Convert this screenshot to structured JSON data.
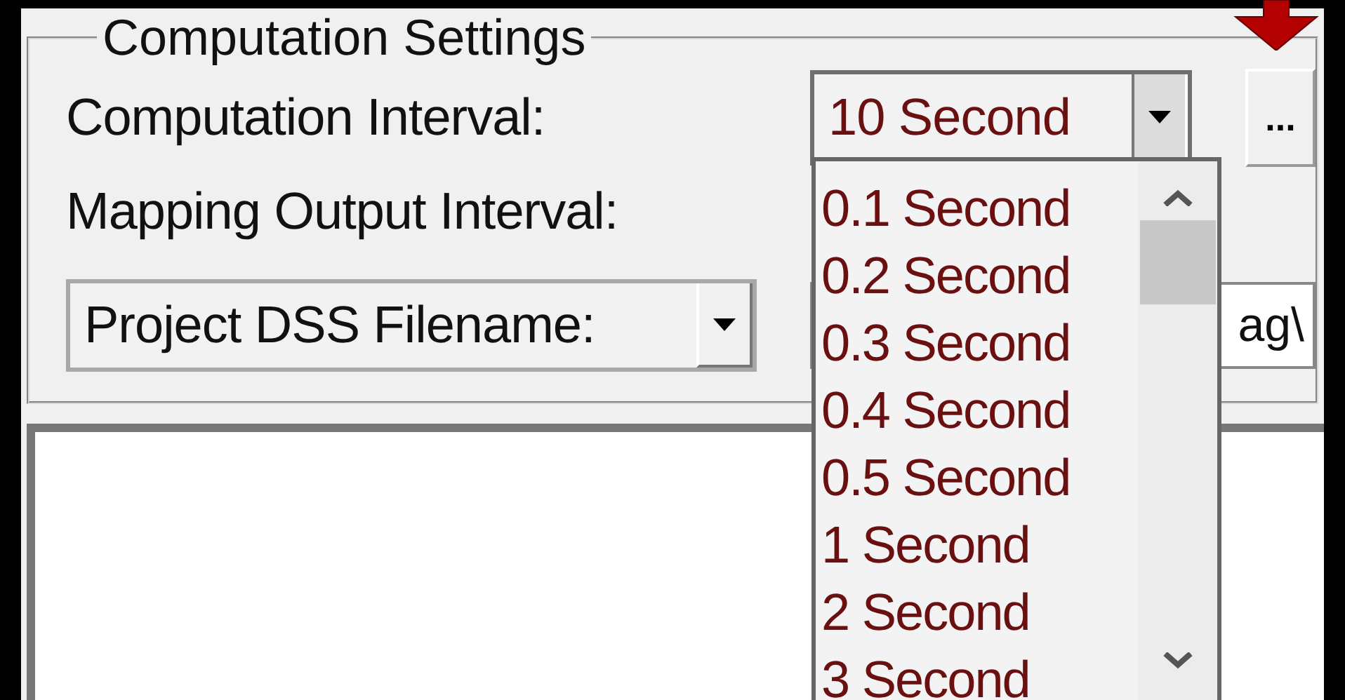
{
  "group": {
    "title": "Computation Settings"
  },
  "computation_interval": {
    "label": "Computation Interval:",
    "value": "10 Second",
    "expanded": true,
    "options": [
      {
        "label": "0.1 Second",
        "selected": false
      },
      {
        "label": "0.2 Second",
        "selected": false
      },
      {
        "label": "0.3 Second",
        "selected": false
      },
      {
        "label": "0.4 Second",
        "selected": false
      },
      {
        "label": "0.5 Second",
        "selected": false
      },
      {
        "label": "1 Second",
        "selected": false
      },
      {
        "label": "2 Second",
        "selected": false
      },
      {
        "label": "3 Second",
        "selected": false
      }
    ]
  },
  "browse_button": {
    "label": "..."
  },
  "mapping_output_interval": {
    "label": "Mapping Output Interval:"
  },
  "dss": {
    "selector": "Project DSS Filename:",
    "path": "ag\\"
  }
}
